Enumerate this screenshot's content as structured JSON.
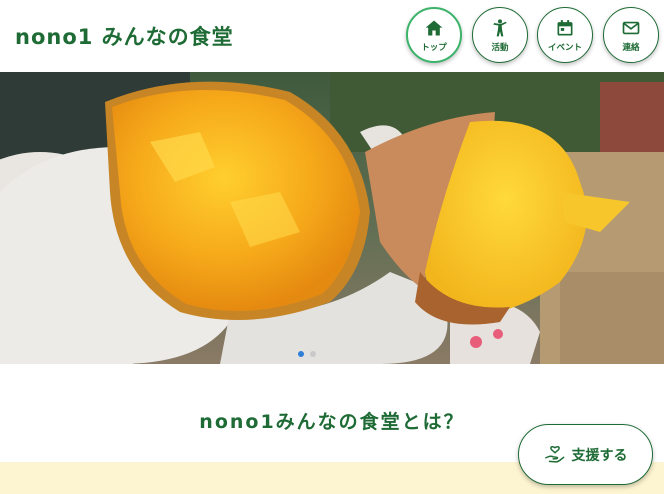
{
  "header": {
    "site_title": "nono1 みんなの食堂",
    "nav": [
      {
        "label": "トップ",
        "icon": "home-icon"
      },
      {
        "label": "活動",
        "icon": "person-activity-icon"
      },
      {
        "label": "イベント",
        "icon": "calendar-icon"
      },
      {
        "label": "連絡",
        "icon": "mail-icon"
      }
    ]
  },
  "hero": {
    "image": "roasted-sweet-potatoes-photo",
    "slide_count": 2,
    "active_slide": 1
  },
  "main": {
    "about_title": "nono1みんなの食堂とは？"
  },
  "support_button": {
    "label": "支援する",
    "icon": "hand-heart-icon"
  },
  "colors": {
    "brand_green": "#1e6b35",
    "active_ring": "#3bb36a",
    "cream": "#fdf4d1",
    "dot_active": "#2f7fd6"
  }
}
